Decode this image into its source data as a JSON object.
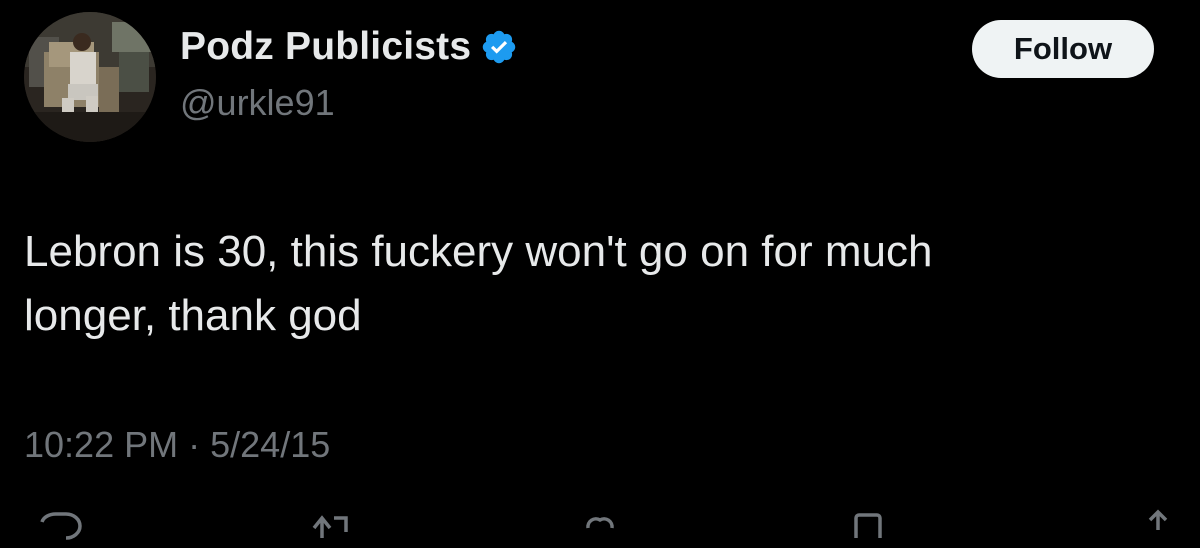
{
  "user": {
    "display_name": "Podz Publicists",
    "handle": "@urkle91",
    "verified_icon": "verified-badge-icon",
    "avatar": "avatar-photo"
  },
  "follow_button": {
    "label": "Follow"
  },
  "tweet": {
    "text": "Lebron is 30, this fuckery won't go on for much\nlonger, thank god",
    "time": "10:22 PM",
    "separator": "·",
    "date": "5/24/15"
  },
  "actions": [
    {
      "icon": "reply-icon"
    },
    {
      "icon": "retweet-icon"
    },
    {
      "icon": "like-icon"
    },
    {
      "icon": "bookmark-icon"
    },
    {
      "icon": "share-icon"
    }
  ],
  "colors": {
    "background": "#000000",
    "primary_text": "#e7e9ea",
    "secondary_text": "#71767b",
    "verified_blue": "#1d9bf0",
    "follow_bg": "#eff3f4"
  }
}
